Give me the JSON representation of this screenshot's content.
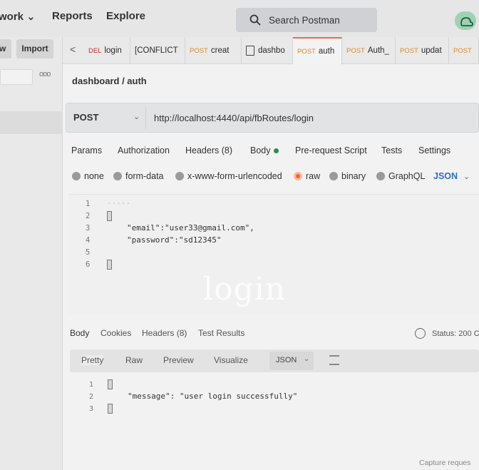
{
  "header": {
    "nav": [
      "work ⌄",
      "Reports",
      "Explore"
    ],
    "search_label": "Search Postman"
  },
  "sidebar": {
    "new_label": "w",
    "import_label": "Import",
    "more": "ooo"
  },
  "tabs": {
    "back": "<",
    "items": [
      {
        "method": "DEL",
        "label": "login"
      },
      {
        "method": "",
        "label": "[CONFLICT"
      },
      {
        "method": "POST",
        "label": "creat"
      },
      {
        "method": "",
        "label": "dashbo"
      },
      {
        "method": "POST",
        "label": "auth"
      },
      {
        "method": "POST",
        "label": "Auth_"
      },
      {
        "method": "POST",
        "label": "updat"
      },
      {
        "method": "POST",
        "label": ""
      }
    ]
  },
  "breadcrumb": "dashboard / auth",
  "request": {
    "method": "POST",
    "url": "http://localhost:4440/api/fbRoutes/login",
    "tabs": [
      "Params",
      "Authorization",
      "Headers (8)",
      "Body",
      "Pre-request Script",
      "Tests",
      "Settings"
    ],
    "body_modes": [
      "none",
      "form-data",
      "x-www-form-urlencoded",
      "raw",
      "binary",
      "GraphQL"
    ],
    "format": "JSON",
    "line_numbers": [
      "1",
      "2",
      "3",
      "4",
      "5",
      "6"
    ],
    "code_line_1": "·····",
    "code_email": "\"email\":\"user33@gmail.com\",",
    "code_password": "\"password\":\"sd12345\""
  },
  "overlay_text": "login",
  "response": {
    "tabs": [
      "Body",
      "Cookies",
      "Headers (8)",
      "Test Results"
    ],
    "status": "Status: 200 C",
    "views": [
      "Pretty",
      "Raw",
      "Preview",
      "Visualize"
    ],
    "format": "JSON",
    "line_numbers": [
      "1",
      "2",
      "3"
    ],
    "code_message": "\"message\": \"user login successfully\""
  },
  "footer": {
    "capture": "Capture reques"
  }
}
